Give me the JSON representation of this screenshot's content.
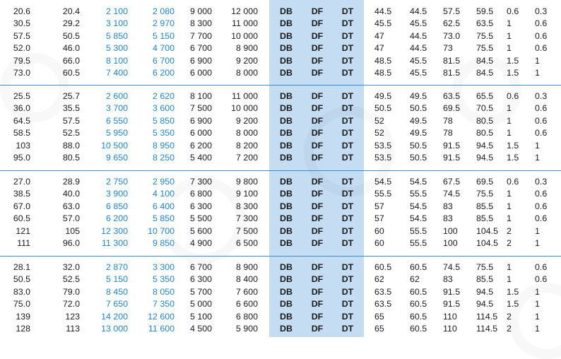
{
  "columns": [
    {
      "key": "c0",
      "align": "r",
      "cls": ""
    },
    {
      "key": "c1",
      "align": "r",
      "cls": ""
    },
    {
      "key": "c2",
      "align": "r",
      "cls": "blue"
    },
    {
      "key": "c3",
      "align": "r",
      "cls": "blue"
    },
    {
      "key": "c4",
      "align": "r",
      "cls": ""
    },
    {
      "key": "c5",
      "align": "r",
      "cls": ""
    },
    {
      "key": "c6",
      "align": "c",
      "cls": "bold"
    },
    {
      "key": "c7",
      "align": "c",
      "cls": "bold"
    },
    {
      "key": "c8",
      "align": "c",
      "cls": "bold"
    },
    {
      "key": "c9",
      "align": "l",
      "cls": ""
    },
    {
      "key": "c10",
      "align": "l",
      "cls": ""
    },
    {
      "key": "c11",
      "align": "l",
      "cls": ""
    },
    {
      "key": "c12",
      "align": "l",
      "cls": ""
    },
    {
      "key": "c13",
      "align": "l",
      "cls": ""
    },
    {
      "key": "c14",
      "align": "l",
      "cls": ""
    }
  ],
  "groups": [
    [
      [
        "20.6",
        "20.4",
        "2 100",
        "2 080",
        "9 000",
        "12 000",
        "DB",
        "DF",
        "DT",
        "44.5",
        "44.5",
        "57.5",
        "59.5",
        "0.6",
        "0.3"
      ],
      [
        "30.5",
        "29.2",
        "3 100",
        "2 970",
        "8 300",
        "11 000",
        "DB",
        "DF",
        "DT",
        "45.5",
        "45.5",
        "62.5",
        "63.5",
        "1",
        "0.6"
      ],
      [
        "57.5",
        "50.5",
        "5 850",
        "5 150",
        "7 700",
        "10 000",
        "DB",
        "DF",
        "DT",
        "47",
        "44.5",
        "73.0",
        "75.5",
        "1",
        "0.6"
      ],
      [
        "52.0",
        "46.0",
        "5 300",
        "4 700",
        "6 700",
        "8 900",
        "DB",
        "DF",
        "DT",
        "47",
        "44.5",
        "73",
        "75.5",
        "1",
        "0.6"
      ],
      [
        "79.5",
        "66.0",
        "8 100",
        "6 700",
        "6 900",
        "9 200",
        "DB",
        "DF",
        "DT",
        "48.5",
        "45.5",
        "81.5",
        "84.5",
        "1.5",
        "1"
      ],
      [
        "73.0",
        "60.5",
        "7 400",
        "6 200",
        "6 000",
        "8 000",
        "DB",
        "DF",
        "DT",
        "48.5",
        "45.5",
        "81.5",
        "84.5",
        "1.5",
        "1"
      ]
    ],
    [
      [
        "25.5",
        "25.7",
        "2 600",
        "2 620",
        "8 100",
        "11 000",
        "DB",
        "DF",
        "DT",
        "49.5",
        "49.5",
        "63.5",
        "65.5",
        "0.6",
        "0.3"
      ],
      [
        "36.0",
        "35.5",
        "3 700",
        "3 600",
        "7 500",
        "10 000",
        "DB",
        "DF",
        "DT",
        "50.5",
        "50.5",
        "69.5",
        "70.5",
        "1",
        "0.6"
      ],
      [
        "64.5",
        "57.5",
        "6 550",
        "5 850",
        "6 900",
        "9 200",
        "DB",
        "DF",
        "DT",
        "52",
        "49.5",
        "78",
        "80.5",
        "1",
        "0.6"
      ],
      [
        "58.5",
        "52.5",
        "5 950",
        "5 350",
        "6 000",
        "8 000",
        "DB",
        "DF",
        "DT",
        "52",
        "49.5",
        "78",
        "80.5",
        "1",
        "0.6"
      ],
      [
        "103",
        "88.0",
        "10 500",
        "8 950",
        "6 200",
        "8 200",
        "DB",
        "DF",
        "DT",
        "53.5",
        "50.5",
        "91.5",
        "94.5",
        "1.5",
        "1"
      ],
      [
        "95.0",
        "80.5",
        "9 650",
        "8 250",
        "5 400",
        "7 200",
        "DB",
        "DF",
        "DT",
        "53.5",
        "50.5",
        "91.5",
        "94.5",
        "1.5",
        "1"
      ]
    ],
    [
      [
        "27.0",
        "28.9",
        "2 750",
        "2 950",
        "7 300",
        "9 800",
        "DB",
        "DF",
        "DT",
        "54.5",
        "54.5",
        "67.5",
        "69.5",
        "0.6",
        "0.3"
      ],
      [
        "38.5",
        "40.0",
        "3 900",
        "4 100",
        "6 800",
        "9 100",
        "DB",
        "DF",
        "DT",
        "55.5",
        "55.5",
        "74.5",
        "75.5",
        "1",
        "0.6"
      ],
      [
        "67.0",
        "63.0",
        "6 850",
        "6 400",
        "6 300",
        "8 300",
        "DB",
        "DF",
        "DT",
        "57",
        "54.5",
        "83",
        "85.5",
        "1",
        "0.6"
      ],
      [
        "60.5",
        "57.0",
        "6 200",
        "5 850",
        "5 500",
        "7 300",
        "DB",
        "DF",
        "DT",
        "57",
        "54.5",
        "83",
        "85.5",
        "1",
        "0.6"
      ],
      [
        "121",
        "105",
        "12 300",
        "10 700",
        "5 600",
        "7 500",
        "DB",
        "DF",
        "DT",
        "60",
        "55.5",
        "100",
        "104.5",
        "2",
        "1"
      ],
      [
        "111",
        "96.0",
        "11 300",
        "9 850",
        "4 900",
        "6 500",
        "DB",
        "DF",
        "DT",
        "60",
        "55.5",
        "100",
        "104.5",
        "2",
        "1"
      ]
    ],
    [
      [
        "28.1",
        "32.0",
        "2 870",
        "3 300",
        "6 700",
        "8 900",
        "DB",
        "DF",
        "DT",
        "60.5",
        "60.5",
        "74.5",
        "75.5",
        "1",
        "0.6"
      ],
      [
        "50.5",
        "52.5",
        "5 150",
        "5 350",
        "6 300",
        "8 400",
        "DB",
        "DF",
        "DT",
        "62",
        "62",
        "83",
        "85.5",
        "1",
        "0.6"
      ],
      [
        "83.0",
        "79.0",
        "8 450",
        "8 050",
        "5 700",
        "7 600",
        "DB",
        "DF",
        "DT",
        "63.5",
        "60.5",
        "91.5",
        "94.5",
        "1.5",
        "1"
      ],
      [
        "75.0",
        "72.0",
        "7 650",
        "7 350",
        "5 000",
        "6 600",
        "DB",
        "DF",
        "DT",
        "63.5",
        "60.5",
        "91.5",
        "94.5",
        "1.5",
        "1"
      ],
      [
        "139",
        "123",
        "14 200",
        "12 600",
        "5 100",
        "6 800",
        "DB",
        "DF",
        "DT",
        "65",
        "60.5",
        "110",
        "114.5",
        "2",
        "1"
      ],
      [
        "128",
        "113",
        "13 000",
        "11 600",
        "4 500",
        "5 900",
        "DB",
        "DF",
        "DT",
        "65",
        "60.5",
        "110",
        "114.5",
        "2",
        "1"
      ]
    ]
  ]
}
